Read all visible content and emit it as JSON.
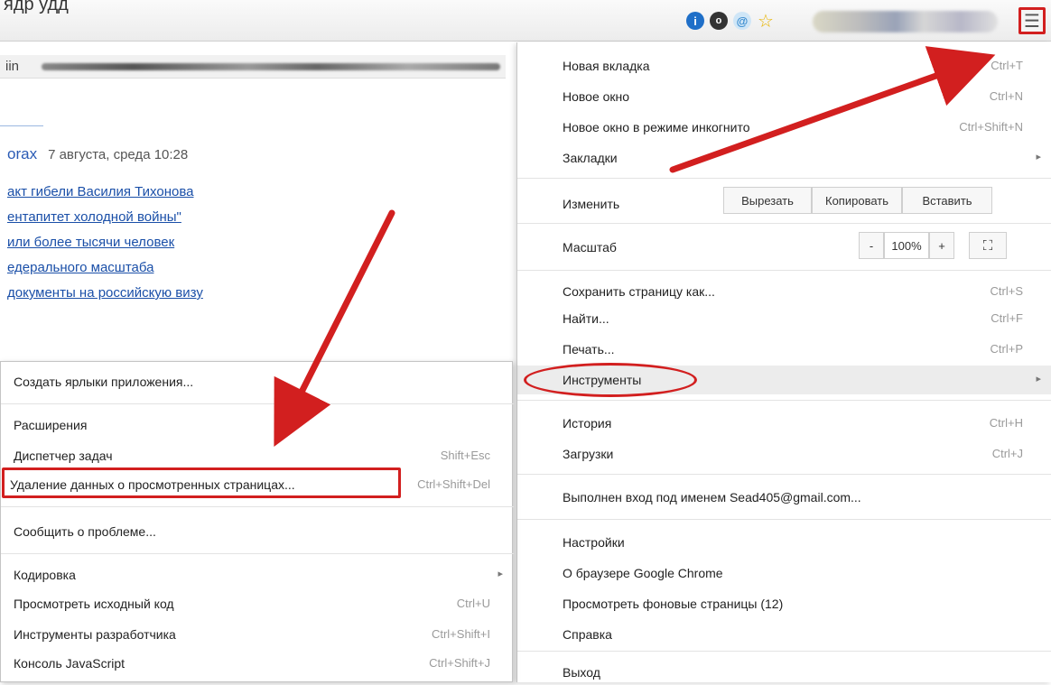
{
  "top_cut_text": "ядр     удд",
  "toolbar": {
    "icons": [
      "info-icon",
      "dark-circle-icon",
      "swirl-icon",
      "bookmark-star-icon"
    ],
    "menu_icon": "hamburger-menu-icon",
    "menu_glyph": "☰"
  },
  "page": {
    "partial_label": "iin",
    "headline": "orax",
    "headline_date": "7 августа, среда 10:28",
    "news": [
      "акт гибели Василия Тихонова",
      "ентапитет холодной войны\"",
      "или более тысячи человек",
      "едерального масштаба",
      "документы на российскую визу"
    ]
  },
  "menu": {
    "new_tab": "Новая вкладка",
    "new_tab_sc": "Ctrl+T",
    "new_window": "Новое окно",
    "new_window_sc": "Ctrl+N",
    "incognito": "Новое окно в режиме инкогнито",
    "incognito_sc": "Ctrl+Shift+N",
    "bookmarks": "Закладки",
    "edit": "Изменить",
    "cut": "Вырезать",
    "copy": "Копировать",
    "paste": "Вставить",
    "zoom": "Масштаб",
    "zoom_minus": "-",
    "zoom_value": "100%",
    "zoom_plus": "+",
    "fullscreen_glyph": "⛶",
    "save_page": "Сохранить страницу как...",
    "save_page_sc": "Ctrl+S",
    "find": "Найти...",
    "find_sc": "Ctrl+F",
    "print": "Печать...",
    "print_sc": "Ctrl+P",
    "tools": "Инструменты",
    "history": "История",
    "history_sc": "Ctrl+H",
    "downloads": "Загрузки",
    "downloads_sc": "Ctrl+J",
    "signed_in": "Выполнен вход под именем Sead405@gmail.com...",
    "settings": "Настройки",
    "about": "О браузере Google Chrome",
    "bg_pages": "Просмотреть фоновые страницы (12)",
    "help": "Справка",
    "exit": "Выход",
    "arrow": "▸"
  },
  "submenu": {
    "app_shortcuts": "Создать ярлыки приложения...",
    "extensions": "Расширения",
    "task_manager": "Диспетчер задач",
    "task_manager_sc": "Shift+Esc",
    "clear_data": "Удаление данных о просмотренных страницах...",
    "clear_data_sc": "Ctrl+Shift+Del",
    "report": "Сообщить о проблеме...",
    "encoding": "Кодировка",
    "view_source": "Просмотреть исходный код",
    "view_source_sc": "Ctrl+U",
    "dev_tools": "Инструменты разработчика",
    "dev_tools_sc": "Ctrl+Shift+I",
    "js_console": "Консоль JavaScript",
    "js_console_sc": "Ctrl+Shift+J"
  },
  "colors": {
    "highlight": "#d21f1f",
    "link": "#1a4fa8"
  }
}
